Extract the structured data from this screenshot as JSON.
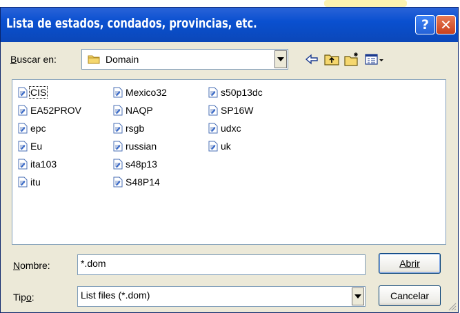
{
  "window": {
    "title": "Lista de estados, condados, provincias, etc.",
    "help_symbol": "?",
    "close_symbol": "✕"
  },
  "lookin": {
    "label": "Buscar en:",
    "value": "Domain"
  },
  "toolbar": {
    "icons": [
      "back-arrow-icon",
      "up-folder-icon",
      "new-folder-icon",
      "view-menu-icon"
    ]
  },
  "files": {
    "column1": [
      "CIS",
      "EA52PROV",
      "epc",
      "Eu",
      "ita103",
      "itu"
    ],
    "column2": [
      "Mexico32",
      "NAQP",
      "rsgb",
      "russian",
      "s48p13",
      "S48P14"
    ],
    "column3": [
      "s50p13dc",
      "SP16W",
      "udxc",
      "uk"
    ]
  },
  "filename": {
    "label": "Nombre:",
    "value": "*.dom"
  },
  "filetype": {
    "label": "Tipo:",
    "value": "List files (*.dom)"
  },
  "buttons": {
    "open": "Abrir",
    "cancel": "Cancelar"
  },
  "colors": {
    "title_bar": "#0b52d4",
    "dialog_bg": "#ece9d8",
    "close_btn": "#d4532c"
  }
}
